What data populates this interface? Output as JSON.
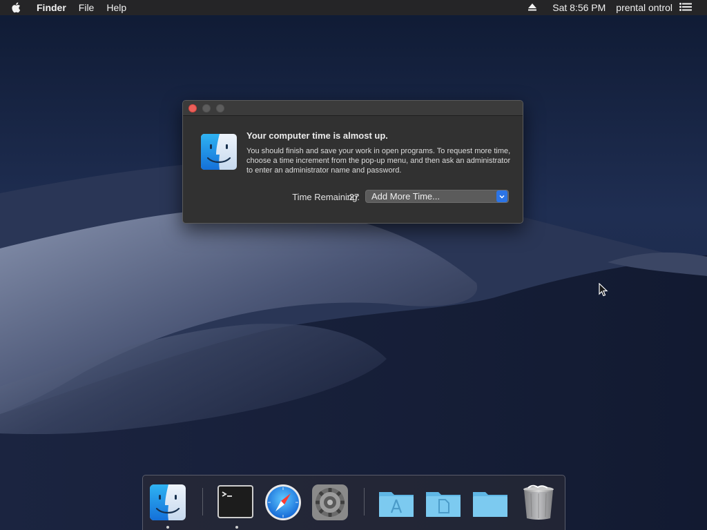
{
  "menubar": {
    "app_name": "Finder",
    "menus": [
      "File",
      "Help"
    ],
    "clock": "Sat 8:56 PM",
    "user": "prental ontrol",
    "icons": {
      "apple": "apple-icon",
      "eject": "eject-icon",
      "list": "notification-list-icon"
    }
  },
  "dialog": {
    "title": "Your computer time is almost up.",
    "body": "You should finish and save your work in open programs. To request more time, choose a time increment from the pop-up menu, and then ask an administrator to enter an administrator name and password.",
    "time_label": "Time Remaining:",
    "time_value": ":27",
    "popup": {
      "selected": "Add More Time..."
    },
    "icon": "finder-icon"
  },
  "dock": {
    "items": [
      {
        "name": "Finder",
        "icon": "finder-icon",
        "running": true
      },
      {
        "name": "Terminal",
        "icon": "terminal-icon",
        "running": true
      },
      {
        "name": "Safari",
        "icon": "safari-icon",
        "running": false
      },
      {
        "name": "System Preferences",
        "icon": "gear-icon",
        "running": false
      },
      {
        "name": "Applications",
        "icon": "applications-folder-icon",
        "running": false
      },
      {
        "name": "Documents",
        "icon": "documents-folder-icon",
        "running": false
      },
      {
        "name": "Downloads",
        "icon": "folder-icon",
        "running": false
      },
      {
        "name": "Trash",
        "icon": "trash-icon",
        "running": false
      }
    ]
  },
  "colors": {
    "menubar": "#252527",
    "dialog_bg": "#313131",
    "close_button": "#ec5f5a",
    "popup_accent": "#2b74e6",
    "sky": "#1e2a45"
  }
}
